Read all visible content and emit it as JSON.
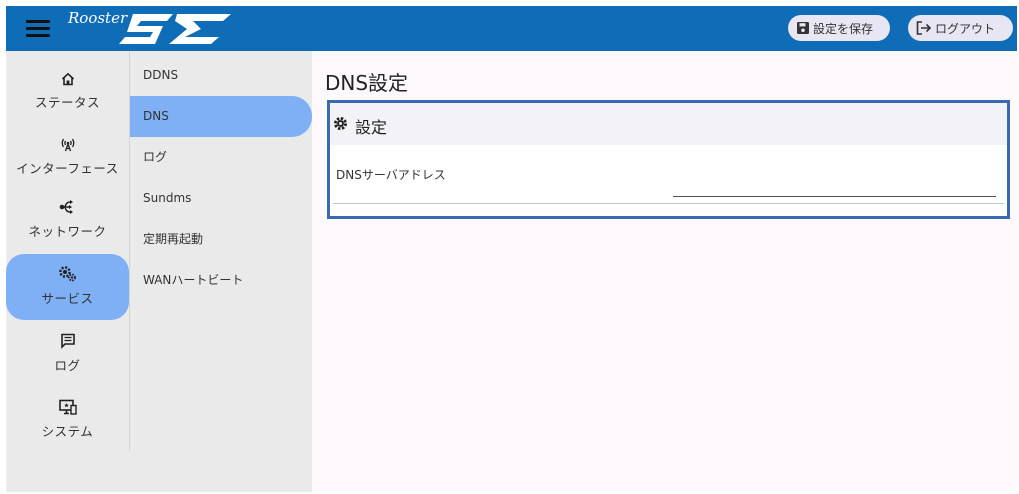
{
  "header": {
    "brand_script": "Rooster",
    "save_button": "設定を保存",
    "logout_button": "ログアウト",
    "colors": {
      "bar": "#0f6cb6",
      "button_bg": "#e8e6f2"
    }
  },
  "nav": {
    "items": [
      {
        "label": "ステータス",
        "icon": "home-icon"
      },
      {
        "label": "インターフェース",
        "icon": "antenna-icon"
      },
      {
        "label": "ネットワーク",
        "icon": "network-icon"
      },
      {
        "label": "サービス",
        "icon": "gears-icon",
        "active": true
      },
      {
        "label": "ログ",
        "icon": "message-icon"
      },
      {
        "label": "システム",
        "icon": "monitor-icon"
      }
    ]
  },
  "subnav": {
    "items": [
      {
        "label": "DDNS"
      },
      {
        "label": "DNS",
        "active": true
      },
      {
        "label": "ログ"
      },
      {
        "label": "Sundms"
      },
      {
        "label": "定期再起動"
      },
      {
        "label": "WANハートビート"
      }
    ]
  },
  "main": {
    "title": "DNS設定",
    "card": {
      "title": "設定",
      "field_label": "DNSサーバアドレス",
      "field_value": ""
    }
  },
  "colors": {
    "active_item": "#7fb0f6",
    "card_border": "#3a6bb2"
  }
}
